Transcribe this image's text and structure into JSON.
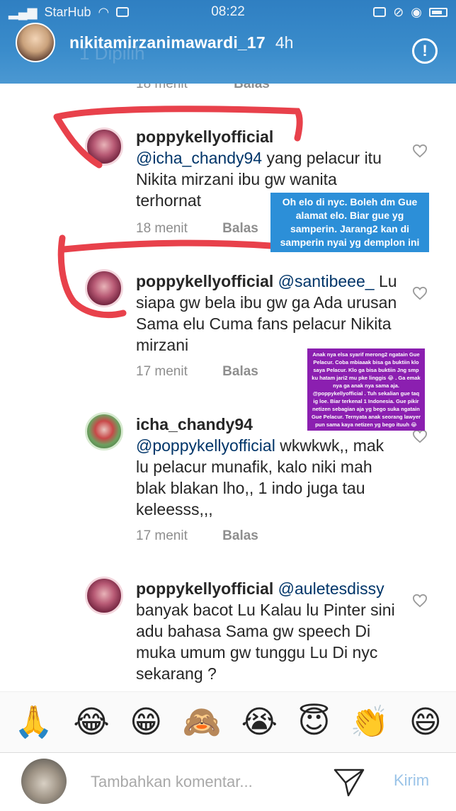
{
  "status_bar": {
    "carrier": "StarHub",
    "time": "08:22"
  },
  "story": {
    "username": "nikitamirzanimawardi_17",
    "time": "4h",
    "subtitle": "1 Dipilih"
  },
  "partial_row": {
    "time": "18 menit",
    "reply": "Balas"
  },
  "comments": [
    {
      "username": "poppykellyofficial",
      "mention": "@icha_chandy94",
      "text": "yang pelacur itu Nikita mirzani ibu gw wanita terhornat",
      "time": "18 menit",
      "reply": "Balas"
    },
    {
      "username": "poppykellyofficial",
      "mention": "@santibeee_",
      "text": "Lu siapa gw bela ibu gw ga Ada urusan Sama elu Cuma fans pelacur Nikita mirzani",
      "time": "17 menit",
      "reply": "Balas"
    },
    {
      "username": "icha_chandy94",
      "mention": "@poppykellyofficial",
      "text": "wkwkwk,, mak lu pelacur munafik, kalo niki mah blak blakan lho,, 1 indo juga tau keleesss,,,",
      "time": "17 menit",
      "reply": "Balas"
    },
    {
      "username": "poppykellyofficial",
      "mention": "@auletesdissy",
      "text": "banyak bacot Lu Kalau lu Pinter sini adu bahasa Sama gw speech Di muka umum gw tunggu Lu Di nyc sekarang ?"
    }
  ],
  "captions": {
    "blue": "Oh elo di nyc. Boleh dm Gue alamat elo. Biar gue yg samperin. Jarang2 kan di samperin nyai yg demplon ini",
    "purple": "Anak nya elsa syarif merong2 ngatain Gue Pelacur. Coba mbiaaak bisa ga buktiin klo saya Pelacur. Klo ga bisa buktiin Jng smp ku hatam jari2 mu pke linggis 😂 . Ga emak nya ga anak nya sama aja. @poppykellyofficial . Tuh sekalian gue taq ig loe. Biar terkenal 1 Indonesia. Gue pikir netizen sebagian aja yg bego suka ngatain Gue Pelacur. Ternyata anak seorang lawyer pun sama kaya netizen yg bego ituuh 😂"
  },
  "emoji_bar": [
    "🙏",
    "😂",
    "😁",
    "🙈",
    "😭",
    "😇",
    "👏",
    "😄"
  ],
  "composer": {
    "placeholder": "Tambahkan komentar...",
    "post_label": "Kirim"
  },
  "colors": {
    "header_blue": "#3a8ccb",
    "annotation_red": "#e8414b",
    "caption_blue": "#2c8fd8",
    "caption_purple": "#8b1fb0",
    "mention": "#003569"
  }
}
